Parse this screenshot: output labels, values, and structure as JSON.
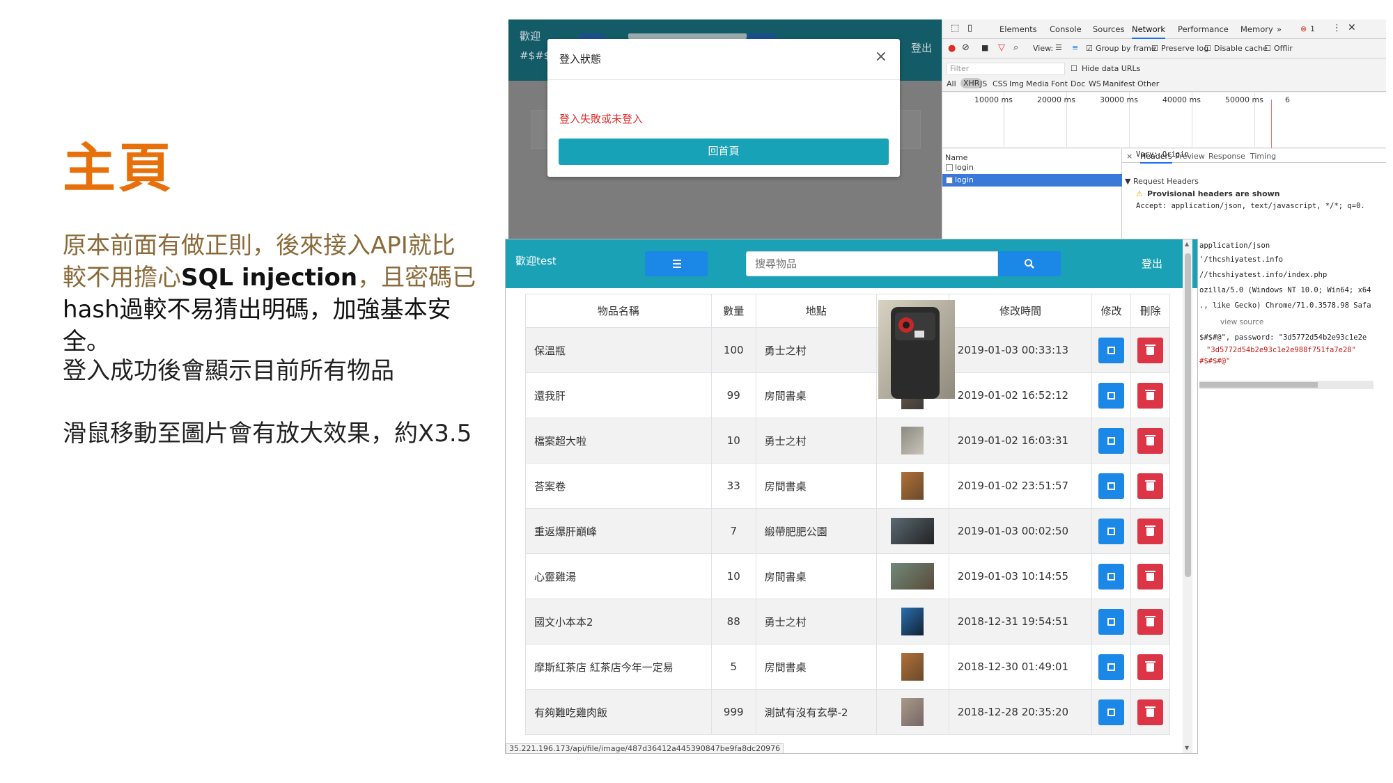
{
  "slide": {
    "title": "主頁",
    "para1_line1": "原本前面有做正則，後來接入API就比",
    "para1_line2a": "較不用擔心",
    "para1_line2b": "SQL injection",
    "para1_line2c": "，且密碼已",
    "para1_line3": "hash過較不易猜出明碼，加強基本安全。",
    "para2": "登入成功後會顯示目前所有物品",
    "para3": "滑鼠移動至圖片會有放大效果，約X3.5"
  },
  "login_screenshot": {
    "app_welcome_line1": "歡迎",
    "app_welcome_line2": "#$#$",
    "app_logout": "登出",
    "modal": {
      "title": "登入狀態",
      "close": "×",
      "message": "登入失敗或未登入",
      "home_button": "回首頁"
    },
    "devtools": {
      "tabs": [
        "Elements",
        "Console",
        "Sources",
        "Network",
        "Performance",
        "Memory",
        "»"
      ],
      "error_count": "1",
      "toolbar": {
        "view_label": "View:",
        "group_by_frame": "Group by frame",
        "preserve_log": "Preserve log",
        "disable_cache": "Disable cache",
        "offline": "Offlir"
      },
      "filter_placeholder": "Filter",
      "hide_data_urls": "Hide data URLs",
      "types": [
        "All",
        "XHR",
        "JS",
        "CSS",
        "Img",
        "Media",
        "Font",
        "Doc",
        "WS",
        "Manifest",
        "Other"
      ],
      "timeline_ticks": [
        "10000 ms",
        "20000 ms",
        "30000 ms",
        "40000 ms",
        "50000 ms",
        "6"
      ],
      "name_header": "Name",
      "requests": [
        "login",
        "login"
      ],
      "detail_tabs": [
        "Headers",
        "Preview",
        "Response",
        "Timing"
      ],
      "detail_close": "×",
      "vary": "Vary: Origin",
      "request_headers": "▼ Request Headers",
      "provisional": "Provisional headers are shown",
      "accept": "Accept: application/json, text/javascript, */*; q=0."
    }
  },
  "devtools_strip": {
    "lines": [
      "application/json",
      "'/thcshiyatest.info",
      "//thcshiyatest.info/index.php",
      "ozilla/5.0 (Windows NT 10.0; Win64; x64",
      "., like Gecko) Chrome/71.0.3578.98 Safa",
      "view source",
      "$#$#@\", password: \"3d5772d54b2e93c1e2e",
      "\"3d5772d54b2e93c1e2e988f751fa7e28\"",
      "#$#$#@\""
    ]
  },
  "main_page": {
    "welcome": "歡迎test",
    "search_placeholder": "搜尋物品",
    "logout": "登出",
    "headers": [
      "物品名稱",
      "數量",
      "地點",
      "",
      "修改時間",
      "修改",
      "刪除"
    ],
    "rows": [
      {
        "name": "保溫瓶",
        "qty": "100",
        "loc": "勇士之村",
        "time": "2019-01-03 00:33:13"
      },
      {
        "name": "還我肝",
        "qty": "99",
        "loc": "房間書桌",
        "time": "2019-01-02 16:52:12"
      },
      {
        "name": "檔案超大啦",
        "qty": "10",
        "loc": "勇士之村",
        "time": "2019-01-02 16:03:31"
      },
      {
        "name": "荅案卷",
        "qty": "33",
        "loc": "房間書桌",
        "time": "2019-01-02 23:51:57"
      },
      {
        "name": "重返爆肝巔峰",
        "qty": "7",
        "loc": "緞帶肥肥公園",
        "time": "2019-01-03 00:02:50"
      },
      {
        "name": "心靈雞湯",
        "qty": "10",
        "loc": "房間書桌",
        "time": "2019-01-03 10:14:55"
      },
      {
        "name": "國文小本本2",
        "qty": "88",
        "loc": "勇士之村",
        "time": "2018-12-31 19:54:51"
      },
      {
        "name": "摩斯紅茶店 紅茶店今年一定易",
        "qty": "5",
        "loc": "房間書桌",
        "time": "2018-12-30 01:49:01"
      },
      {
        "name": "有夠難吃雞肉飯",
        "qty": "999",
        "loc": "測試有沒有玄學-2",
        "time": "2018-12-28 20:35:20"
      }
    ],
    "status_url": "35.221.196.173/api/file/image/487d36412a445390847be9fa8dc20976"
  },
  "colors": {
    "title_orange": "#e8700a",
    "header_teal": "#1ba1b5",
    "primary_blue": "#1b87e6",
    "danger_red": "#dc3545",
    "modal_button": "#17a2b8"
  }
}
